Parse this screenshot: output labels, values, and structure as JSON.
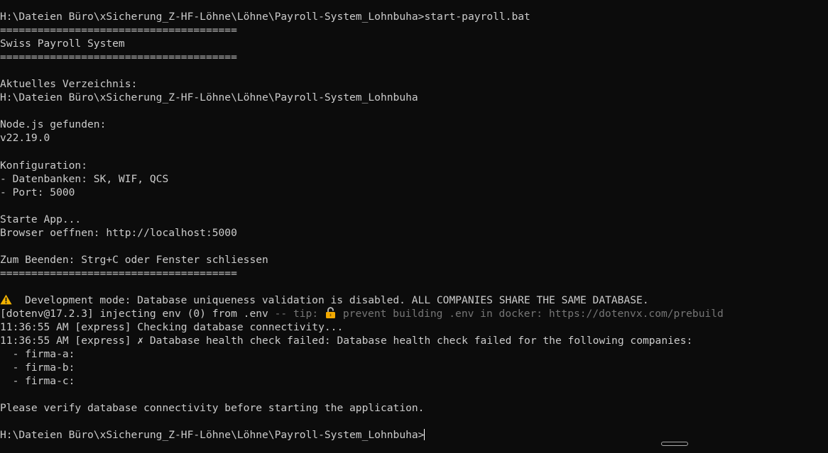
{
  "terminal": {
    "lines": {
      "l0": "H:\\Dateien Büro\\xSicherung_Z-HF-Löhne\\Löhne\\Payroll-System_Lohnbuha>start-payroll.bat",
      "l1": "======================================",
      "l2": "Swiss Payroll System",
      "l3": "======================================",
      "l5": "Aktuelles Verzeichnis:",
      "l6": "H:\\Dateien Büro\\xSicherung_Z-HF-Löhne\\Löhne\\Payroll-System_Lohnbuha",
      "l8": "Node.js gefunden:",
      "l9": "v22.19.0",
      "l11": "Konfiguration:",
      "l12": "- Datenbanken: SK, WIF, QCS",
      "l13": "- Port: 5000",
      "l15": "Starte App...",
      "l16": "Browser oeffnen: http://localhost:5000",
      "l18": "Zum Beenden: Strg+C oder Fenster schliessen",
      "l19": "======================================",
      "l21": "Development mode: Database uniqueness validation is disabled. ALL COMPANIES SHARE THE SAME DATABASE.",
      "l22_main": "[dotenv@17.2.3] injecting env (0) from .env",
      "l22_tip_prefix": " -- tip: ",
      "l22_tip_text": "prevent building .env in docker: https://dotenvx.com/prebuild",
      "l23": "11:36:55 AM [express] Checking database connectivity...",
      "l24": "11:36:55 AM [express] ✗ Database health check failed: Database health check failed for the following companies:",
      "l25": "  - firma-a:",
      "l26": "  - firma-b:",
      "l27": "  - firma-c:",
      "l29": "Please verify database connectivity before starting the application.",
      "l31": "H:\\Dateien Büro\\xSicherung_Z-HF-Löhne\\Löhne\\Payroll-System_Lohnbuha>"
    },
    "icons": {
      "warning": "warning-icon",
      "lock": "lock-icon"
    },
    "colors": {
      "background": "#0c0c0c",
      "foreground": "#cccccc",
      "dim": "#767676",
      "warning": "#f5b400",
      "lock": "#f2a900"
    }
  }
}
